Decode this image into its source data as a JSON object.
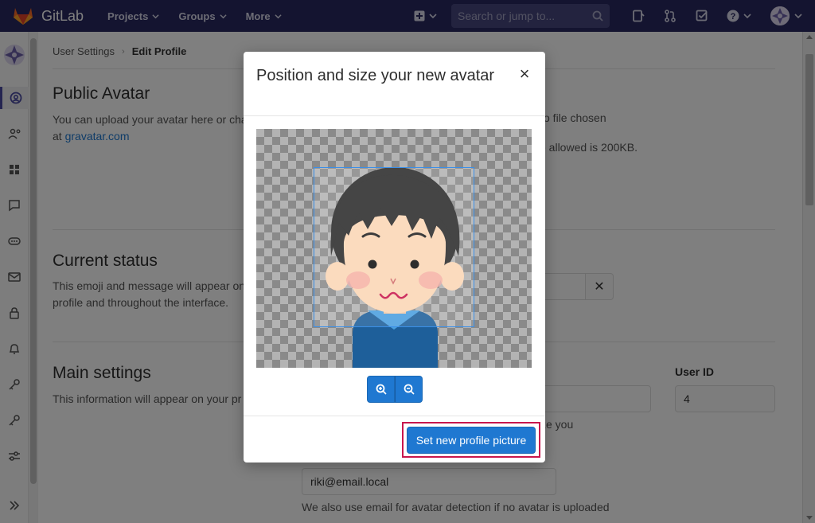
{
  "navbar": {
    "brand": "GitLab",
    "menu": [
      "Projects",
      "Groups",
      "More"
    ],
    "search_placeholder": "Search or jump to..."
  },
  "breadcrumb": {
    "parent": "User Settings",
    "current": "Edit Profile"
  },
  "sections": {
    "avatar": {
      "title": "Public Avatar",
      "desc_line1": "You can upload your avatar here or cha",
      "desc_prefix": "at ",
      "desc_link": "gravatar.com",
      "file_status": "o file chosen",
      "size_note": "e allowed is 200KB."
    },
    "status": {
      "title": "Current status",
      "desc_line1": "This emoji and message will appear on",
      "desc_line2": "profile and throughout the interface.",
      "clear_symbol": "✕"
    },
    "main": {
      "title": "Main settings",
      "desc": "This information will appear on your pr",
      "user_id_label": "User ID",
      "user_id_value": "4",
      "name_note": "ze you",
      "email_value": "riki@email.local",
      "email_note": "We also use email for avatar detection if no avatar is uploaded"
    }
  },
  "modal": {
    "title": "Position and size your new avatar",
    "close_symbol": "×",
    "submit_label": "Set new profile picture"
  },
  "colors": {
    "navbar": "#292961",
    "primary": "#1f78d1",
    "highlight": "#c8174d"
  }
}
